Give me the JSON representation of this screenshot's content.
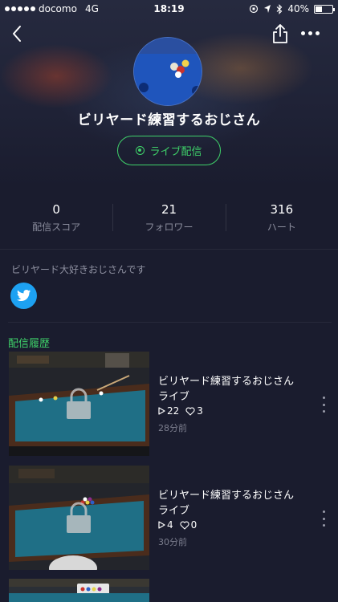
{
  "status_bar": {
    "carrier": "docomo",
    "network": "4G",
    "time": "18:19",
    "battery": "40%",
    "battery_level": 0.4
  },
  "nav": {
    "back_icon": "chevron-left-icon",
    "share_icon": "share-icon",
    "more_icon": "more-horizontal-icon"
  },
  "profile": {
    "name": "ビリヤード練習するおじさん",
    "live_button_label": "ライブ配信",
    "bio": "ビリヤード大好きおじさんです"
  },
  "stats": [
    {
      "value": "0",
      "label": "配信スコア"
    },
    {
      "value": "21",
      "label": "フォロワー"
    },
    {
      "value": "316",
      "label": "ハート"
    }
  ],
  "social": {
    "twitter_icon": "twitter-icon"
  },
  "history": {
    "section_title": "配信履歴",
    "items": [
      {
        "title": "ビリヤード練習するおじさんライブ",
        "views": "22",
        "hearts": "3",
        "time": "28分前"
      },
      {
        "title": "ビリヤード練習するおじさんライブ",
        "views": "4",
        "hearts": "0",
        "time": "30分前"
      }
    ]
  },
  "colors": {
    "accent": "#3fd16a",
    "background": "#1a1c2e",
    "twitter": "#1da1f2",
    "table_felt": "#1f6f86"
  }
}
